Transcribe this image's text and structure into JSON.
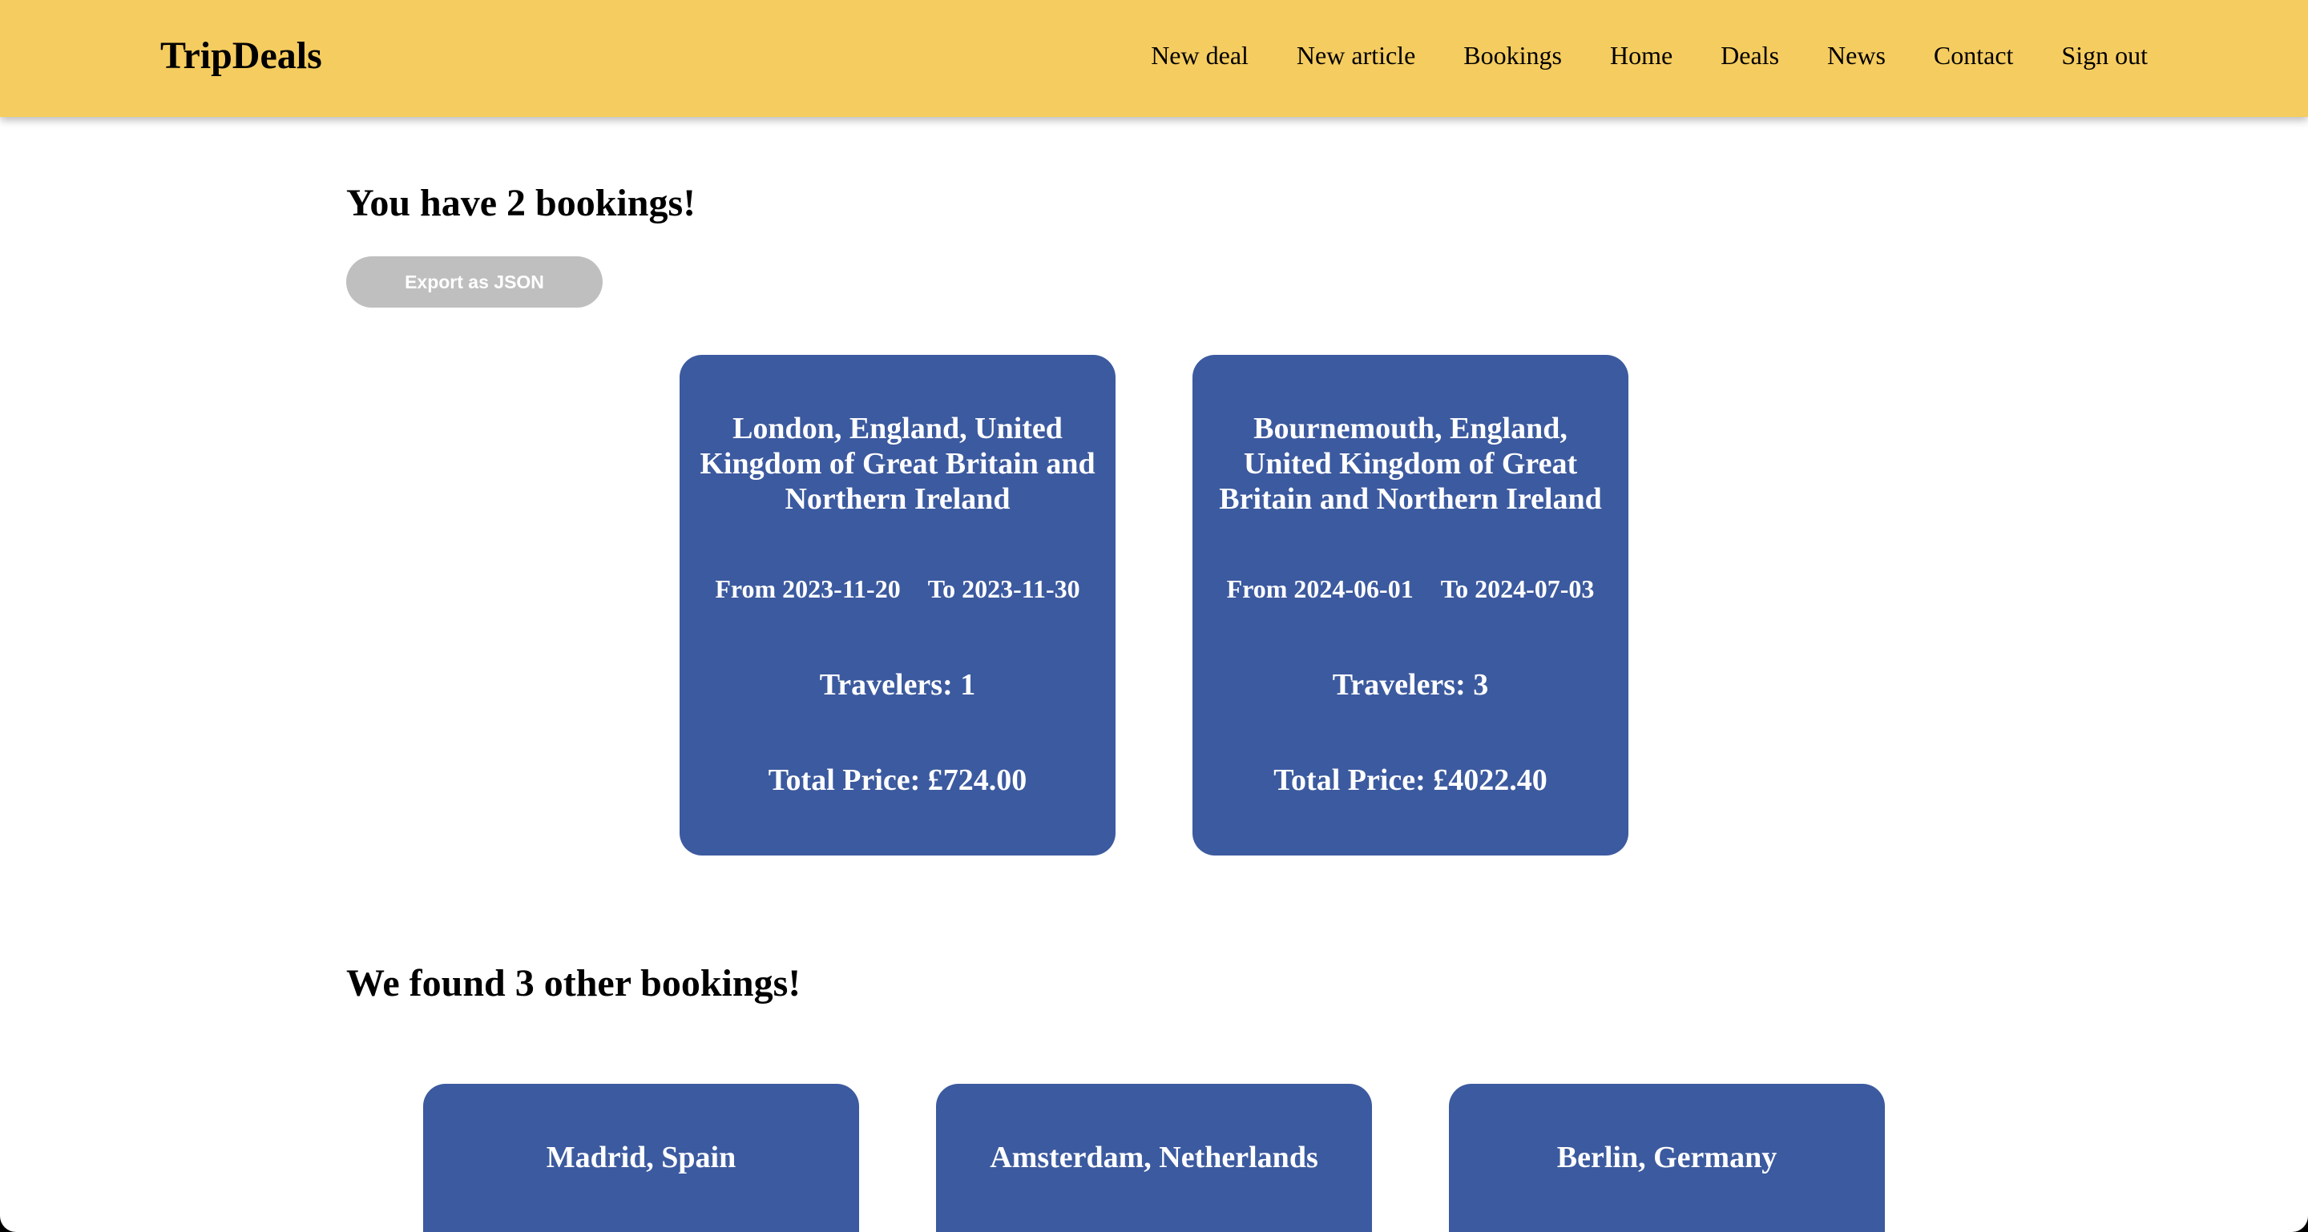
{
  "brand": "TripDeals",
  "nav": [
    "New deal",
    "New article",
    "Bookings",
    "Home",
    "Deals",
    "News",
    "Contact",
    "Sign out"
  ],
  "bookings_heading": "You have 2 bookings!",
  "export_label": "Export as JSON",
  "bookings": [
    {
      "destination": "London, England, United Kingdom of Great Britain and Northern Ireland",
      "from": "From 2023-11-20",
      "to": "To 2023-11-30",
      "travelers": "Travelers: 1",
      "total": "Total Price: £724.00"
    },
    {
      "destination": "Bournemouth, England, United Kingdom of Great Britain and Northern Ireland",
      "from": "From 2024-06-01",
      "to": "To 2024-07-03",
      "travelers": "Travelers: 3",
      "total": "Total Price: £4022.40"
    }
  ],
  "other_heading": "We found 3 other bookings!",
  "other_bookings": [
    {
      "destination": "Madrid, Spain"
    },
    {
      "destination": "Amsterdam, Netherlands"
    },
    {
      "destination": "Berlin, Germany"
    }
  ],
  "colors": {
    "navbar": "#f5cc5f",
    "card": "#3c5a9f",
    "export_button": "#bfbfbf"
  }
}
